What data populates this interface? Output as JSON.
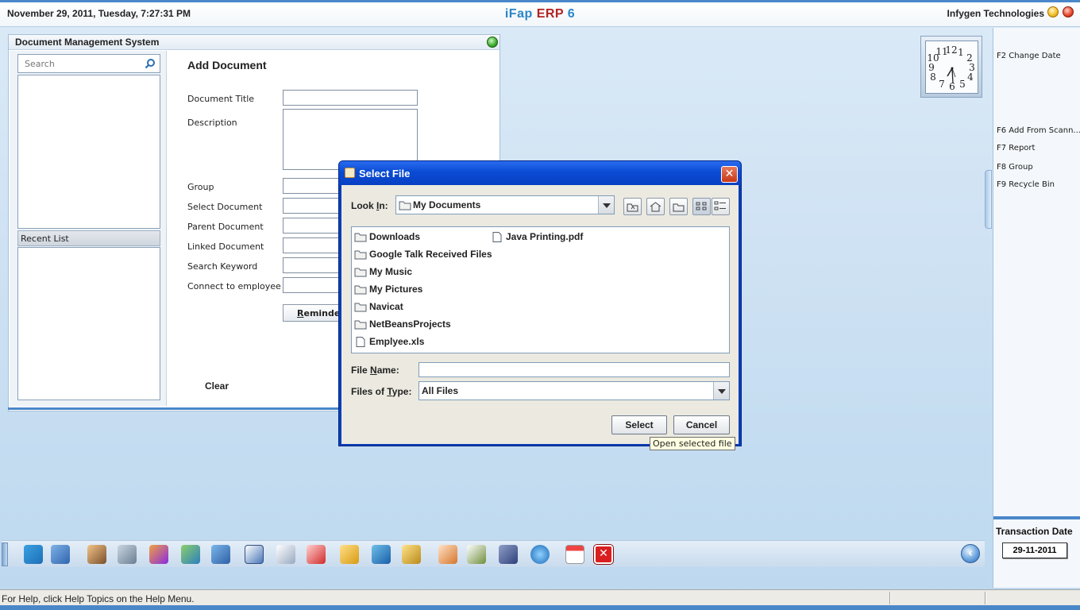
{
  "topbar": {
    "datetime": "November  29, 2011, Tuesday, 7:27:31 PM",
    "title_part1": "iFap",
    "title_part2": "ERP",
    "title_part3": "6",
    "company": "Infygen Technologies"
  },
  "dms": {
    "window_title": "Document Management System",
    "search_placeholder": "Search",
    "recent_list_label": "Recent List",
    "form_heading": "Add Document",
    "fields": [
      "Document Title",
      "Description",
      "Group",
      "Select Document",
      "Parent Document",
      "Linked Document",
      "Search Keyword",
      "Connect to employee"
    ],
    "reminder_mnemonic": "R",
    "reminder_rest": "eminder",
    "clear_label": "Clear"
  },
  "dialog": {
    "title": "Select File",
    "close_glyph": "✕",
    "look_in_label": "Look In:",
    "look_in_mnemonic": "I",
    "look_in_value": "My Documents",
    "files": [
      {
        "name": "Downloads",
        "kind": "folder-icon"
      },
      {
        "name": "Google Talk Received Files",
        "kind": "folder-icon"
      },
      {
        "name": "My Music",
        "kind": "folder-icon"
      },
      {
        "name": "My Pictures",
        "kind": "folder-icon"
      },
      {
        "name": "Navicat",
        "kind": "folder-icon"
      },
      {
        "name": "NetBeansProjects",
        "kind": "folder-icon"
      },
      {
        "name": "Emplyee.xls",
        "kind": "file-icon"
      },
      {
        "name": "Java Printing.pdf",
        "kind": "file-icon"
      }
    ],
    "file_name_label_pre": "File ",
    "file_name_label_mn": "N",
    "file_name_label_post": "ame:",
    "file_name_value": "",
    "files_of_type_pre": "Files of ",
    "files_of_type_mn": "T",
    "files_of_type_post": "ype:",
    "files_of_type_value": "All Files",
    "select_button": "Select",
    "cancel_button": "Cancel",
    "tooltip": "Open selected file"
  },
  "right_panel": {
    "fkeys": [
      "F2 Change Date",
      "F6 Add From Scann...",
      "F7 Report",
      "F8 Group",
      "F9 Recycle Bin"
    ],
    "transaction_label": "Transaction Date",
    "transaction_date": "29-11-2011"
  },
  "toolbar": {
    "close_glyph": "✕",
    "back_glyph": "‹",
    "left_arrow_glyph": "‹"
  },
  "statusbar": {
    "help_text": "For Help, click Help Topics on the Help Menu."
  },
  "colors": {
    "accent_blue": "#4a87c9",
    "title_blue": "#2a86c7",
    "title_red": "#b22222",
    "dialog_frame": "#0a3fb5",
    "tooltip_bg": "#ffffe1"
  }
}
